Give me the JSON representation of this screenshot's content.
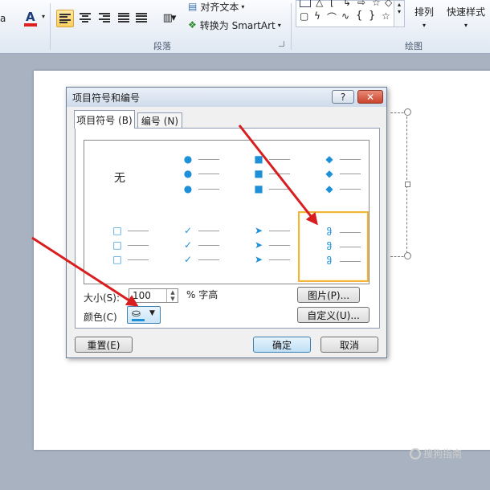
{
  "ribbon": {
    "font_color_label": "A",
    "partial_left": "a",
    "align_text_label": "对齐文本",
    "smartart_label": "转换为 SmartArt",
    "arrange_label": "排列",
    "quick_styles_label": "快速样式",
    "group_paragraph": "段落",
    "group_drawing": "绘图"
  },
  "dialog": {
    "title": "项目符号和编号",
    "help_label": "?",
    "close_label": "✕",
    "tab_bullets": "项目符号 (B)",
    "tab_numbering": "编号 (N)",
    "none_label": "无",
    "size_label": "大小(S):",
    "size_value": "100",
    "size_unit": "% 字高",
    "color_label": "颜色(C)",
    "picture_button": "图片(P)...",
    "customize_button": "自定义(U)...",
    "reset_button": "重置(E)",
    "ok_button": "确定",
    "cancel_button": "取消"
  },
  "bullets": {
    "row1": [
      {
        "name": "none",
        "symbol": ""
      },
      {
        "name": "filled-circle",
        "symbol": "●"
      },
      {
        "name": "filled-square",
        "symbol": "■"
      },
      {
        "name": "diamond",
        "symbol": "◆"
      }
    ],
    "row2": [
      {
        "name": "hollow-square",
        "symbol": "□"
      },
      {
        "name": "check-mark",
        "symbol": "✓"
      },
      {
        "name": "arrowhead",
        "symbol": "➤"
      },
      {
        "name": "custom-glyph",
        "symbol": "ჵ"
      }
    ],
    "selected": "custom-glyph"
  },
  "watermark": "搜狗指南",
  "colors": {
    "accent_blue": "#1e90d8",
    "selection": "#f2b53a",
    "arrow_red": "#d81e1e"
  }
}
